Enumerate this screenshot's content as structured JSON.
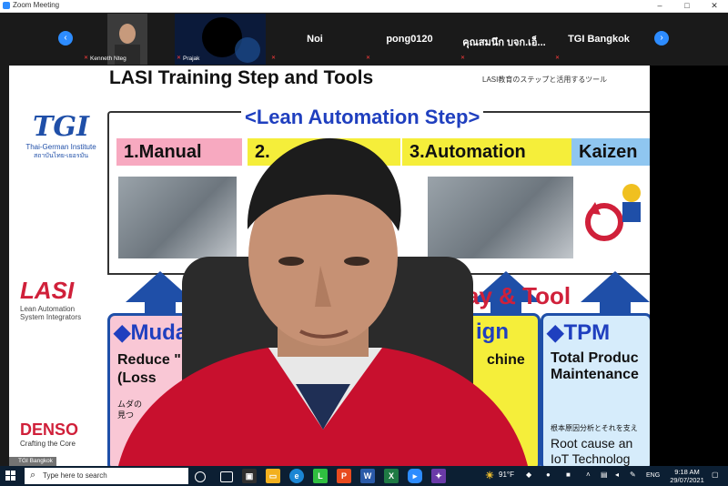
{
  "window": {
    "title": "Zoom Meeting"
  },
  "window_controls": {
    "minimize": "–",
    "maximize": "□",
    "close": "✕"
  },
  "strip": {
    "prev_label": "‹",
    "next_label": "›",
    "tiles": [
      {
        "name": "",
        "caption": "Kenneth Nteg"
      },
      {
        "name": "",
        "caption": "Prajak"
      },
      {
        "name": "Noi",
        "caption": ""
      },
      {
        "name": "pong0120",
        "caption": ""
      },
      {
        "name": "คุณสมนึก บจก.เอ็...",
        "caption": ""
      },
      {
        "name": "TGI Bangkok",
        "caption": ""
      }
    ]
  },
  "slide": {
    "title": "LASI Training Step and Tools",
    "subtitle_jp": "LASI教育のステップと活用するツール",
    "lean_step": "<Lean Automation Step>",
    "steps": [
      "1.Manual",
      "2.",
      "3.Automation",
      "Kaizen"
    ],
    "tool_label": "ay & Tool",
    "panels": [
      {
        "header": "◆Muda",
        "lines": [
          "Reduce \"",
          "(Loss",
          "ムダの",
          "見つ"
        ]
      },
      {
        "header": "ign",
        "lines": [
          "chine"
        ]
      },
      {
        "header": "◆TPM",
        "lines": [
          "Total Produc",
          "Maintenance",
          "根本原因分析とそれを支え",
          "Root cause an",
          "IoT Technolog"
        ]
      }
    ],
    "logos": {
      "tgi": {
        "mark": "TGI",
        "sub": "Thai-German Institute",
        "sub2": "สถาบันไทย-เยอรมัน"
      },
      "lasi": {
        "mark": "LASI",
        "sub1": "Lean Automation",
        "sub2": "System Integrators"
      },
      "denso": {
        "mark": "DENSO",
        "sub": "Crafting the Core"
      }
    }
  },
  "active_speaker": {
    "badge": "TGI Bangkok"
  },
  "taskbar": {
    "search_placeholder": "Type here to search",
    "search_icon": "search-icon",
    "weather": "91°F",
    "language": "ENG",
    "time": "9:18 AM",
    "date": "29/07/2021"
  },
  "colors": {
    "accent": "#2d8cff",
    "slide_blue": "#1f3fbf",
    "slide_red": "#d0203a",
    "taskbar": "#0c1f33"
  }
}
